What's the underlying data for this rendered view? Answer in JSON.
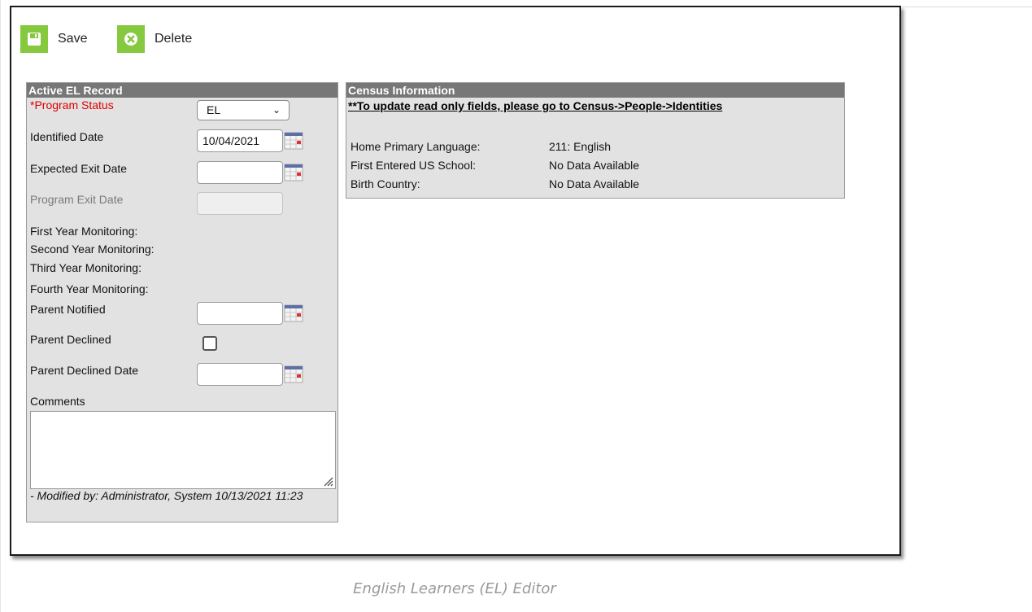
{
  "toolbar": {
    "save_label": "Save",
    "delete_label": "Delete"
  },
  "el_record": {
    "header": "Active EL Record",
    "program_status_label": "*Program Status",
    "program_status_value": "EL",
    "identified_date_label": "Identified Date",
    "identified_date_value": "10/04/2021",
    "expected_exit_date_label": "Expected Exit Date",
    "expected_exit_date_value": "",
    "program_exit_date_label": "Program Exit Date",
    "program_exit_date_value": "",
    "first_year_label": "First Year Monitoring:",
    "second_year_label": "Second Year Monitoring:",
    "third_year_label": "Third Year Monitoring:",
    "fourth_year_label": "Fourth Year Monitoring:",
    "parent_notified_label": "Parent Notified",
    "parent_notified_value": "",
    "parent_declined_label": "Parent Declined",
    "parent_declined_checked": false,
    "parent_declined_date_label": "Parent Declined Date",
    "parent_declined_date_value": "",
    "comments_label": "Comments",
    "comments_value": "",
    "modified_by": "- Modified by: Administrator, System 10/13/2021 11:23"
  },
  "census": {
    "header": "Census Information",
    "note": "**To update read only fields, please go to Census->People->Identities",
    "rows": [
      {
        "label": "Home Primary Language:",
        "value": "211: English"
      },
      {
        "label": "First Entered US School:",
        "value": "No Data Available"
      },
      {
        "label": "Birth Country:",
        "value": "No Data Available"
      }
    ]
  },
  "caption": "English Learners (EL) Editor",
  "colors": {
    "accent_green": "#86c83e",
    "section_header": "#777777",
    "section_bg": "#e2e2e2",
    "required_red": "#e00000"
  }
}
